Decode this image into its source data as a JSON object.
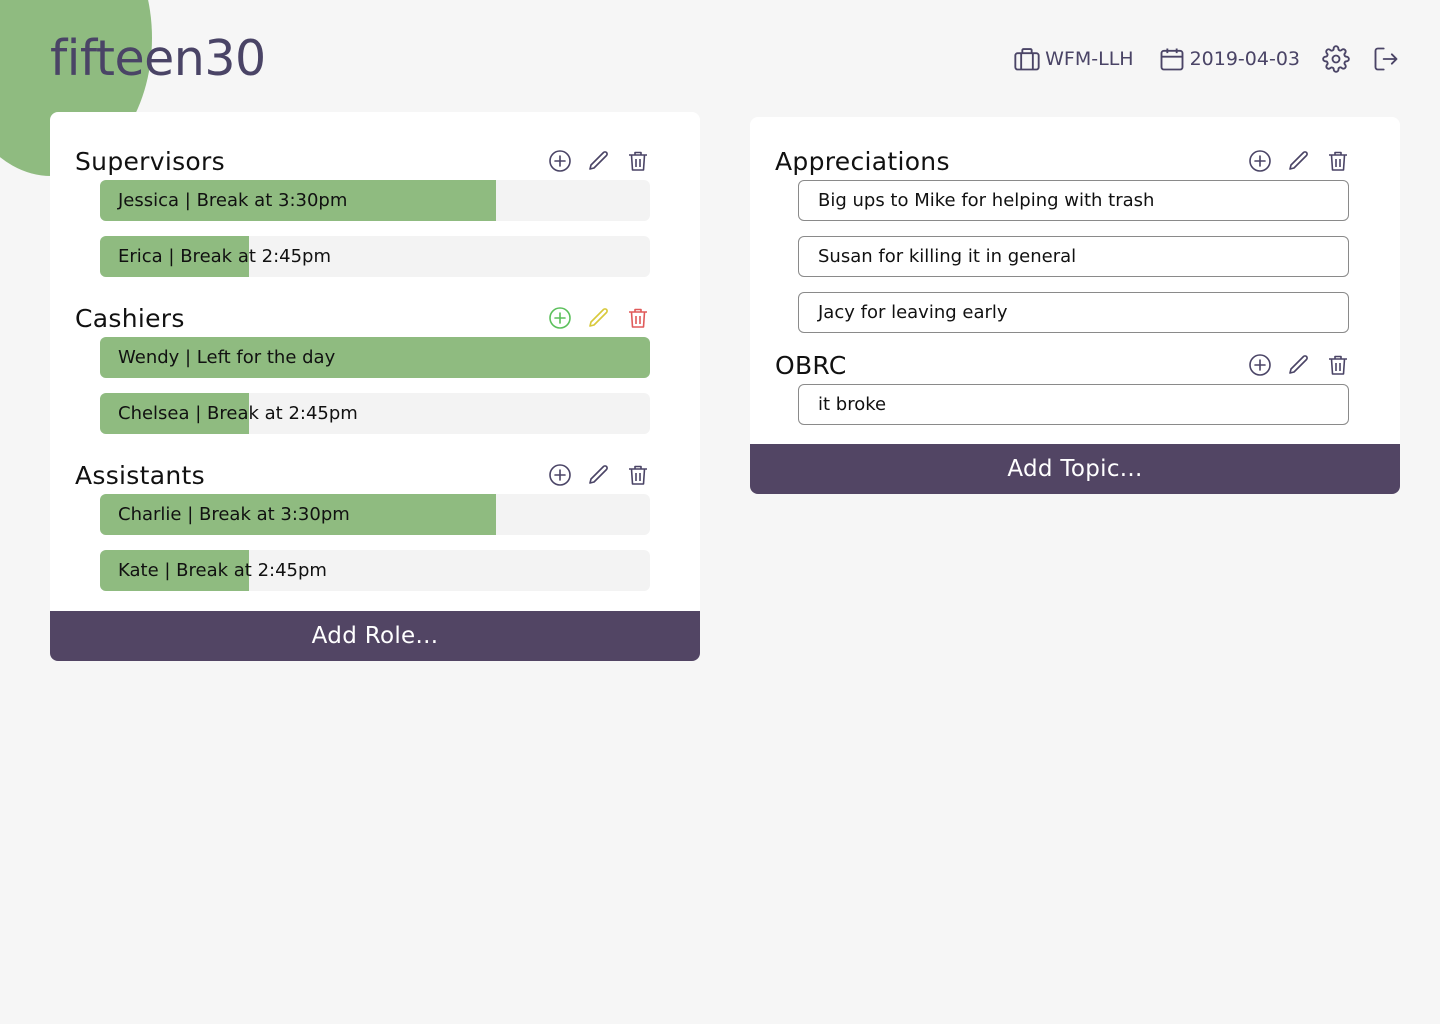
{
  "app": {
    "logo": "fifteen30"
  },
  "header": {
    "store": "WFM-LLH",
    "date": "2019-04-03",
    "store_icon": "briefcase-icon",
    "date_icon": "calendar-icon",
    "settings_icon": "gear-icon",
    "logout_icon": "logout-icon"
  },
  "colors": {
    "accent_green": "#8fbb80",
    "brand_purple": "#524564",
    "add_green": "#5cc05c",
    "edit_yellow": "#d8c93a",
    "delete_red": "#e05a5a"
  },
  "roles": {
    "add_label": "Add Role...",
    "groups": [
      {
        "title": "Supervisors",
        "members": [
          {
            "label": "Jessica | Break at 3:30pm",
            "progress": 0.72
          },
          {
            "label": "Erica | Break at 2:45pm",
            "progress": 0.27
          }
        ]
      },
      {
        "title": "Cashiers",
        "members": [
          {
            "label": "Wendy | Left for the day",
            "progress": 1.0
          },
          {
            "label": "Chelsea | Break at 2:45pm",
            "progress": 0.27
          }
        ]
      },
      {
        "title": "Assistants",
        "members": [
          {
            "label": "Charlie | Break at 3:30pm",
            "progress": 0.72
          },
          {
            "label": "Kate | Break at 2:45pm",
            "progress": 0.27
          }
        ]
      }
    ]
  },
  "topics": {
    "add_label": "Add Topic...",
    "groups": [
      {
        "title": "Appreciations",
        "items": [
          "Big ups to Mike for helping with trash",
          "Susan for killing it in general",
          "Jacy for leaving early"
        ]
      },
      {
        "title": "OBRC",
        "items": [
          "it broke"
        ]
      }
    ]
  }
}
